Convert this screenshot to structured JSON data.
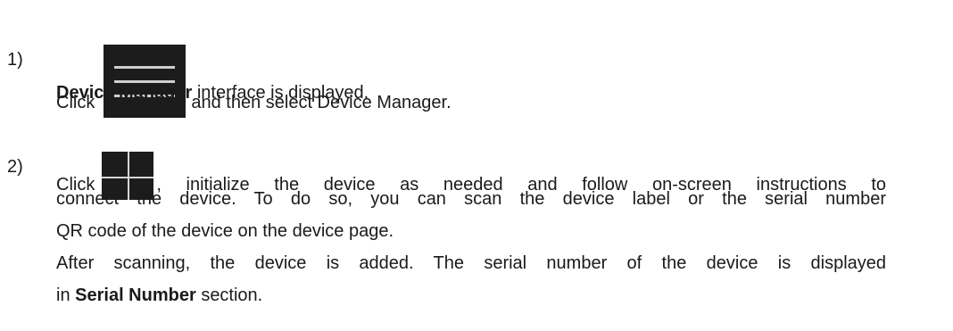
{
  "steps": [
    {
      "number": "1)",
      "click": "Click",
      "icon": "menu-icon",
      "after_icon": "and then select Device Manager.",
      "result_bold": "Device Manager",
      "result_rest": "interface is displayed."
    },
    {
      "number": "2)",
      "click": "Click",
      "icon": "plus-icon",
      "after_icon": ", initialize the device as needed and follow on-screen instructions to",
      "line2": "connect the device. To do so, you can scan the device label or the serial number",
      "line3": "QR code of the device on the device page.",
      "line4": "After scanning, the device is added. The serial number of the device is displayed",
      "line5_prefix": "in",
      "line5_bold": "Serial Number",
      "line5_suffix": "section."
    }
  ],
  "colors": {
    "icon_background": "#1c1c1c",
    "icon_stroke": "#cfcfcf"
  }
}
